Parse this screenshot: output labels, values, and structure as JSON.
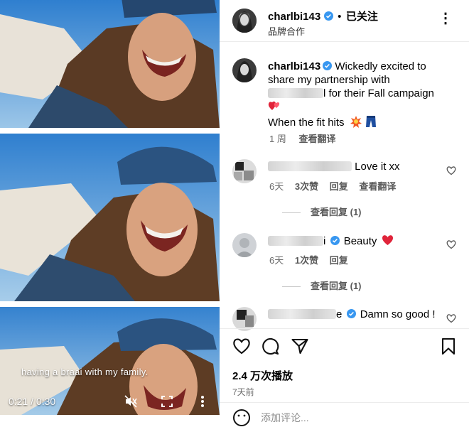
{
  "video": {
    "caption": "having a braai with my family.",
    "time": "0:21 / 0:30"
  },
  "header": {
    "username": "charlbi143",
    "dot": "•",
    "follow_status": "已关注",
    "subtitle": "品牌合作",
    "more": "⋮"
  },
  "post": {
    "username": "charlbi143",
    "caption_line1": " Wickedly excited to",
    "caption_line2": "share my partnership with",
    "caption_line3_suffix": "l for their Fall campaign",
    "caption_line4": "When the fit hits",
    "age": "1 周",
    "translate": "查看翻译"
  },
  "comments": [
    {
      "text": " Love it xx",
      "age": "6天",
      "likes": "3次赞",
      "reply": "回复",
      "translate": "查看翻译",
      "view_replies": "查看回复 (1)"
    },
    {
      "name_suffix": "i",
      "text": "Beauty",
      "age": "6天",
      "likes": "1次赞",
      "reply": "回复",
      "view_replies": "查看回复 (1)"
    },
    {
      "name_suffix": "e",
      "text": "Damn so good !"
    }
  ],
  "stats": {
    "plays": "2.4 万次播放",
    "posted": "7天前"
  },
  "add_comment": {
    "placeholder": "添加评论..."
  },
  "colors": {
    "verified": "#3897f0",
    "heart": "#e0243a",
    "muted_text": "#6b6b6b"
  }
}
